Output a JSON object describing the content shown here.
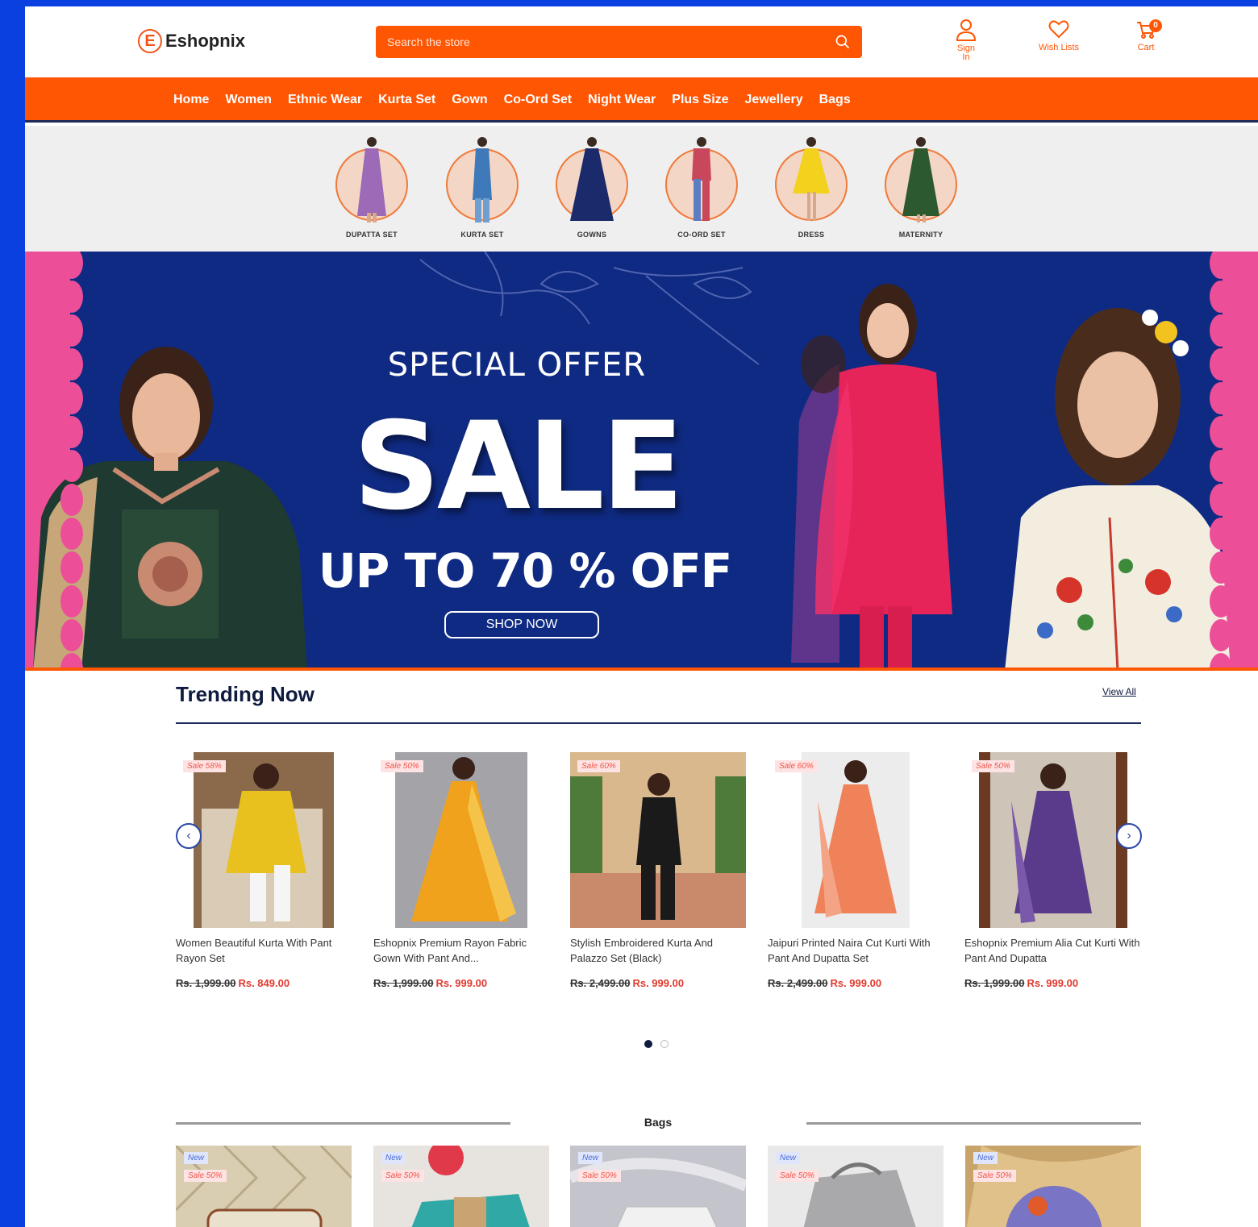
{
  "brand": {
    "logo_letter": "E",
    "name": "Eshopnix"
  },
  "search": {
    "placeholder": "Search the store"
  },
  "header_actions": {
    "sign_in": "Sign In",
    "wish_lists": "Wish Lists",
    "cart": "Cart",
    "cart_count": "0"
  },
  "nav": [
    "Home",
    "Women",
    "Ethnic Wear",
    "Kurta Set",
    "Gown",
    "Co-Ord Set",
    "Night Wear",
    "Plus Size",
    "Jewellery",
    "Bags"
  ],
  "categories": [
    {
      "label": "DUPATTA SET",
      "color": "#9c6ab6"
    },
    {
      "label": "KURTA SET",
      "color": "#3e79b9"
    },
    {
      "label": "GOWNS",
      "color": "#1b2a6a"
    },
    {
      "label": "CO-ORD SET",
      "color": "#c8475a"
    },
    {
      "label": "DRESS",
      "color": "#f2d21d"
    },
    {
      "label": "MATERNITY",
      "color": "#2c5a2e"
    }
  ],
  "hero": {
    "offer": "SPECIAL OFFER",
    "sale": "SALE",
    "discount": "UP TO 70 % OFF",
    "cta": "SHOP NOW"
  },
  "trending": {
    "title": "Trending Now",
    "view_all": "View All",
    "products": [
      {
        "tag": "Sale 58%",
        "name": "Women Beautiful Kurta With Pant Rayon Set",
        "old_price": "Rs. 1,999.00",
        "price": "Rs. 849.00",
        "color": "#e8c11f",
        "bg": "#8a6a4a"
      },
      {
        "tag": "Sale 50%",
        "name": "Eshopnix Premium Rayon Fabric Gown With Pant And...",
        "old_price": "Rs. 1,999.00",
        "price": "Rs. 999.00",
        "color": "#f0a21c",
        "bg": "#a4a4a8"
      },
      {
        "tag": "Sale 60%",
        "name": "Stylish Embroidered Kurta And Palazzo Set (Black)",
        "old_price": "Rs. 2,499.00",
        "price": "Rs. 999.00",
        "color": "#1a1a1a",
        "bg": "#d9b88e"
      },
      {
        "tag": "Sale 60%",
        "name": "Jaipuri Printed Naira Cut Kurti With Pant And Dupatta Set",
        "old_price": "Rs. 2,499.00",
        "price": "Rs. 999.00",
        "color": "#f0825a",
        "bg": "#ececec"
      },
      {
        "tag": "Sale 50%",
        "name": "Eshopnix Premium Alia Cut Kurti With Pant And Dupatta",
        "old_price": "Rs. 1,999.00",
        "price": "Rs. 999.00",
        "color": "#5a3a8a",
        "bg": "#cfc4b8"
      }
    ]
  },
  "bags": {
    "title": "Bags",
    "items": [
      {
        "new_tag": "New",
        "sale_tag": "Sale 50%",
        "bg": "#d9cdb2"
      },
      {
        "new_tag": "New",
        "sale_tag": "Sale 50%",
        "bg": "#e7e3df"
      },
      {
        "new_tag": "New",
        "sale_tag": "Sale 50%",
        "bg": "#c4c4cc"
      },
      {
        "new_tag": "New",
        "sale_tag": "Sale 50%",
        "bg": "#e9e9e9"
      },
      {
        "new_tag": "New",
        "sale_tag": "Sale 50%",
        "bg": "#c9a46a"
      }
    ]
  },
  "colors": {
    "accent": "#ff5604",
    "navy": "#0f2a82",
    "pink": "#ec4f98",
    "page_bg": "#0a3fe0"
  }
}
